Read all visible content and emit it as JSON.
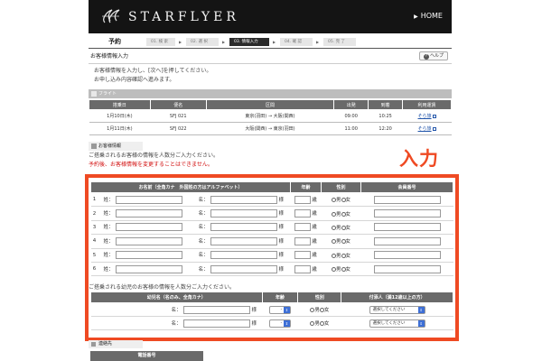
{
  "header": {
    "brand": "STARFLYER",
    "home_label": "HOME",
    "home_arrow": "▶"
  },
  "nav": {
    "title": "予約",
    "steps": [
      {
        "label": "01. 検 索"
      },
      {
        "label": "02. 選 択"
      },
      {
        "label": "03. 情報入力",
        "active": true
      },
      {
        "label": "04. 確 認"
      },
      {
        "label": "05. 完 了"
      }
    ]
  },
  "page": {
    "title": "お客様情報入力",
    "help_label": "ヘルプ",
    "intro_lines": [
      "お客様情報を入力し、[次へ]を押してください。",
      "お申し込み内容確認へ進みます。"
    ],
    "big_label": "入力"
  },
  "flight": {
    "section_label": "フライト",
    "headers": [
      "搭乗日",
      "便名",
      "区間",
      "出発",
      "到着",
      "利用運賃"
    ],
    "rows": [
      {
        "date": "1月10日(木)",
        "flight": "SFJ 021",
        "route": "東京(羽田) → 大阪(関西)",
        "dep": "09:00",
        "arr": "10:25",
        "fare": "そら旅"
      },
      {
        "date": "1月11日(木)",
        "flight": "SFJ 022",
        "route": "大阪(関西) → 東京(羽田)",
        "dep": "11:00",
        "arr": "12:20",
        "fare": "そら旅"
      }
    ]
  },
  "passengers": {
    "section_label": "お客様情報",
    "guide_lines": [
      {
        "text": "ご搭乗されるお客様の情報を人数分ご入力ください。",
        "color": "black"
      },
      {
        "text": "予約後、お客様情報を変更することはできません。",
        "color": "red"
      }
    ],
    "headers": {
      "name": "お名前（全角カナ　外国姓の方はアルファベット）",
      "age": "年齢",
      "gender": "性別",
      "member": "会員番号"
    },
    "last_name_label": "姓：",
    "first_name_label": "名：",
    "honorific": "様",
    "age_unit": "歳",
    "male": "男",
    "female": "女",
    "row_numbers": [
      "1",
      "2",
      "3",
      "4",
      "5",
      "6"
    ]
  },
  "children": {
    "note": "ご搭乗される幼児のお客様の情報を人数分ご入力ください。",
    "headers": {
      "name": "幼児名（名のみ、全角カナ）",
      "age": "年齢",
      "gender": "性別",
      "escort": "付添人（満12歳以上の方）"
    },
    "first_name_label": "名：",
    "honorific": "様",
    "age_default": "-",
    "escort_placeholder": "選択してください",
    "male": "男",
    "female": "女",
    "count": 2
  },
  "contact": {
    "section_label": "連絡先",
    "phone_header": "電話番号"
  },
  "colors": {
    "accent": "#ef4a23",
    "header_bg": "#141414",
    "table_head": "#6a6a6a",
    "notice_red": "#d21010",
    "link": "#2255aa",
    "select_button": "#3d6fd6"
  }
}
